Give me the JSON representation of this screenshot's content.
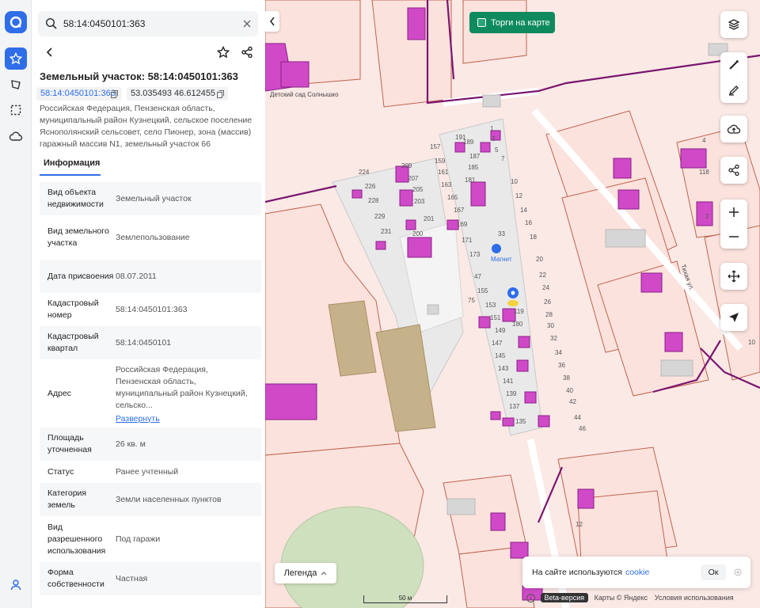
{
  "search": {
    "value": "58:14:0450101:363"
  },
  "parcel": {
    "title": "Земельный участок: 58:14:0450101:363",
    "cadastral_chip": "58:14:0450101:363",
    "coords_chip": "53.035493 46.612455",
    "address": "Российская Федерация, Пензенская область, муниципальный район Кузнецкий, сельское поселение Яснополянский сельсовет, село Пионер, зона (массив) гаражный массив N1, земельный участок 66"
  },
  "tabs": {
    "info": "Информация"
  },
  "rows": [
    {
      "label": "Вид объекта недвижимости",
      "value": "Земельный участок"
    },
    {
      "label": "Вид земельного участка",
      "value": "Землепользование"
    },
    {
      "label": "Дата присвоения",
      "value": "08.07.2011"
    },
    {
      "label": "Кадастровый номер",
      "value": "58:14:0450101:363"
    },
    {
      "label": "Кадастровый квартал",
      "value": "58:14:0450101"
    },
    {
      "label": "Адрес",
      "value": "Российская Федерация, Пензенская область, муниципальный район Кузнецкий, сельско...",
      "link": "Развернуть"
    },
    {
      "label": "Площадь уточненная",
      "value": "26 кв. м"
    },
    {
      "label": "Статус",
      "value": "Ранее учтенный"
    },
    {
      "label": "Категория земель",
      "value": "Земли населенных пунктов"
    },
    {
      "label": "Вид разрешенного использования",
      "value": "Под гаражи"
    },
    {
      "label": "Форма собственности",
      "value": "Частная"
    }
  ],
  "map": {
    "torgi_label": "Торги на карте",
    "legend_label": "Легенда",
    "kindergarten_label": "Детский сад Солнышко",
    "street_label": "Тихая ул.",
    "shop_label": "Магнит",
    "scale_label": "50 м",
    "cookie_text": "На сайте используются",
    "cookie_link": "cookie",
    "cookie_ok": "Ок",
    "footer_beta": "Beta-версия",
    "footer_maps": "Карты © Яндекс",
    "footer_terms": "Условия использования",
    "lot_numbers": [
      "224",
      "226",
      "228",
      "229",
      "231",
      "209",
      "207",
      "205",
      "203",
      "201",
      "200",
      "157",
      "159",
      "161",
      "163",
      "165",
      "167",
      "169",
      "171",
      "173",
      "191",
      "189",
      "187",
      "185",
      "181",
      "1",
      "3",
      "5",
      "7",
      "10",
      "12",
      "14",
      "16",
      "18",
      "20",
      "22",
      "24",
      "26",
      "28",
      "30",
      "32",
      "34",
      "36",
      "38",
      "40",
      "42",
      "44",
      "46",
      "47",
      "155",
      "153",
      "151",
      "149",
      "147",
      "145",
      "143",
      "141",
      "139",
      "137",
      "135",
      "33",
      "75",
      "180",
      "119",
      "118",
      "2",
      "4",
      "10",
      "12"
    ]
  },
  "colors": {
    "accent": "#2f6ee8",
    "parcel_fill": "#fbe9e6",
    "parcel_border": "#b8553f",
    "building": "#d04ac8",
    "torgi": "#0f8a5e",
    "boundary": "#7a1570"
  }
}
